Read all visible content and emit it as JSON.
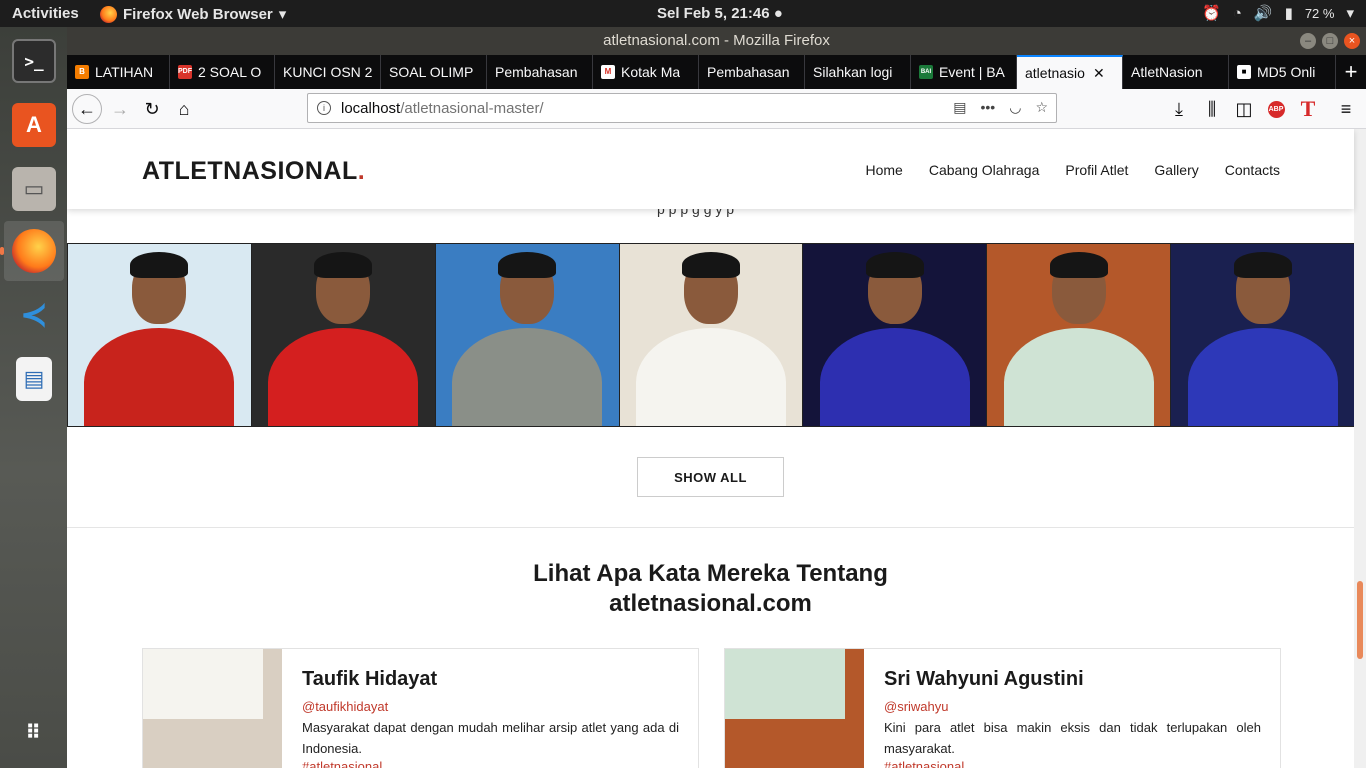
{
  "topbar": {
    "activities": "Activities",
    "app_name": "Firefox Web Browser",
    "clock": "Sel Feb  5, 21:46",
    "battery": "72 %"
  },
  "dock": {
    "items": [
      "terminal",
      "software-center",
      "files",
      "firefox",
      "vscode",
      "document-viewer",
      "show-apps"
    ]
  },
  "window": {
    "title": "atletnasional.com - Mozilla Firefox"
  },
  "tabs": [
    {
      "label": "LATIHAN",
      "favicon": "B",
      "color": "#f57d00"
    },
    {
      "label": "2 SOAL O",
      "favicon": "PDF",
      "color": "#d9342b"
    },
    {
      "label": "KUNCI OSN 2",
      "favicon": "",
      "color": ""
    },
    {
      "label": "SOAL OLIMP",
      "favicon": "",
      "color": ""
    },
    {
      "label": "Pembahasan",
      "favicon": "",
      "color": ""
    },
    {
      "label": "Kotak Ma",
      "favicon": "M",
      "color": "#d93025"
    },
    {
      "label": "Pembahasan",
      "favicon": "",
      "color": ""
    },
    {
      "label": "Silahkan logi",
      "favicon": "",
      "color": ""
    },
    {
      "label": "Event | BA",
      "favicon": "BAI",
      "color": "#1b7a3a"
    },
    {
      "label": "atletnasio",
      "favicon": "",
      "color": "",
      "active": true
    },
    {
      "label": "AtletNasion",
      "favicon": "",
      "color": ""
    },
    {
      "label": "MD5 Onli",
      "favicon": "lock",
      "color": "#ffffff"
    }
  ],
  "navbar": {
    "url_host": "localhost",
    "url_path": "/atletnasional-master/"
  },
  "site": {
    "brand": "ATLETNASIONAL",
    "brand_dot": ".",
    "nav": [
      "Home",
      "Cabang Olahraga",
      "Profil Atlet",
      "Gallery",
      "Contacts"
    ],
    "cut_text": "p p p g g y p",
    "show_all": "SHOW ALL",
    "testimonial_title_line1": "Lihat Apa Kata Mereka Tentang",
    "testimonial_title_line2": "atletnasional.com"
  },
  "gallery": [
    {
      "bg": "#d9e9f2",
      "shirt": "#c8231c"
    },
    {
      "bg": "#2a2a2a",
      "shirt": "#d41f1f"
    },
    {
      "bg": "#3a7dc2",
      "shirt": "#8a8f88"
    },
    {
      "bg": "#e8e2d6",
      "shirt": "#f5f4ef"
    },
    {
      "bg": "#14143a",
      "shirt": "#2d2fb0"
    },
    {
      "bg": "#b4582a",
      "shirt": "#cfe3d4"
    },
    {
      "bg": "#1a2050",
      "shirt": "#2d38b8"
    }
  ],
  "testimonials": [
    {
      "name": "Taufik Hidayat",
      "handle": "@taufikhidayat",
      "message": "Masyarakat dapat dengan mudah melihar arsip atlet yang ada di Indonesia.",
      "tag": "#atletnasional",
      "bg": "#d9cfc2",
      "shirt": "#f5f4ef"
    },
    {
      "name": "Sri Wahyuni Agustini",
      "handle": "@sriwahyu",
      "message": "Kini para atlet bisa makin eksis dan tidak terlupakan oleh masyarakat.",
      "tag": "#atletnasional",
      "bg": "#b4582a",
      "shirt": "#cfe3d4"
    }
  ]
}
